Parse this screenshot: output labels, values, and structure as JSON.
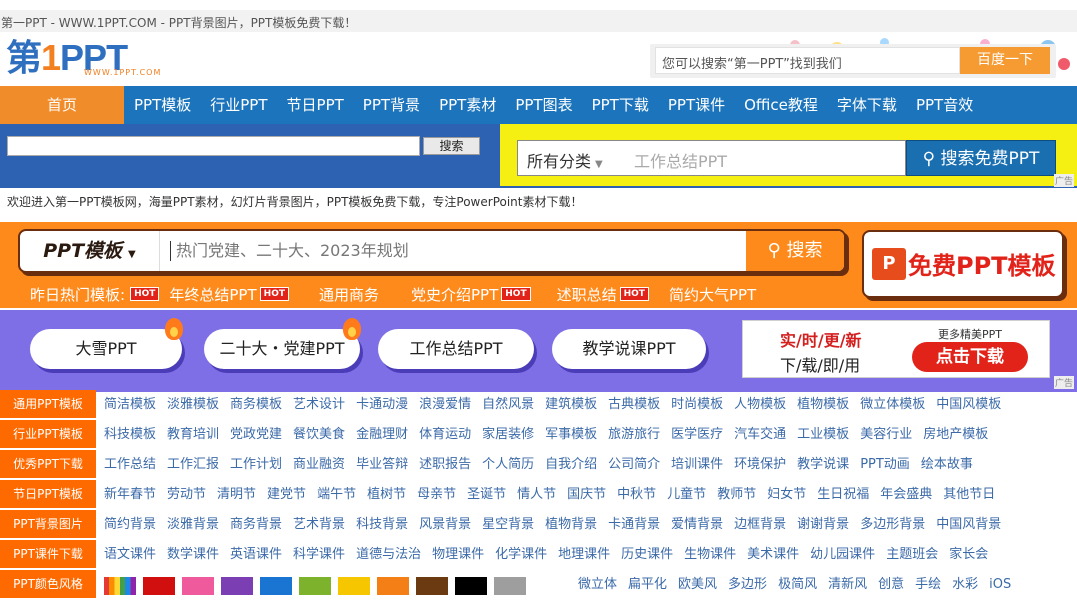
{
  "window": {
    "title": "第一PPT - WWW.1PPT.COM - PPT背景图片，PPT模板免费下载！"
  },
  "logo": {
    "main_prefix": "第",
    "main_one": "1",
    "main_suffix": "PPT",
    "url": "WWW.1PPT.COM"
  },
  "top_search": {
    "placeholder": "您可以搜索“第一PPT”找到我们",
    "button": "百度一下"
  },
  "nav": {
    "home": "首页",
    "items": [
      "PPT模板",
      "行业PPT",
      "节日PPT",
      "PPT背景",
      "PPT素材",
      "PPT图表",
      "PPT下载",
      "PPT课件",
      "Office教程",
      "字体下载",
      "PPT音效"
    ]
  },
  "site_search": {
    "button": "搜索",
    "category": "所有分类",
    "placeholder": "工作总结PPT",
    "submit": "搜索免费PPT",
    "ad_tag": "广告"
  },
  "welcome": "欢迎进入第一PPT模板网，海量PPT素材，幻灯片背景图片，PPT模板免费下载，专注PowerPoint素材下载！",
  "ppt_search": {
    "type": "PPT模板",
    "placeholder": "热门党建、二十大、2023年规划",
    "button": "搜索"
  },
  "free_banner": {
    "logo": "P",
    "text": "免费PPT模板"
  },
  "hot": {
    "label": "昨日热门模板:",
    "badge": "HOT",
    "items": [
      {
        "label": "年终总结PPT",
        "hot": true
      },
      {
        "label": "通用商务",
        "hot": false
      },
      {
        "label": "党史介绍PPT",
        "hot": true
      },
      {
        "label": "述职总结",
        "hot": true
      },
      {
        "label": "简约大气PPT",
        "hot": false
      }
    ]
  },
  "pills": [
    "大雪PPT",
    "二十大・党建PPT",
    "工作总结PPT",
    "教学说课PPT"
  ],
  "promo": {
    "line1": "实/时/更/新",
    "line2": "下/载/即/用",
    "more": "更多精美PPT",
    "button": "点击下载",
    "ad_tag": "广告"
  },
  "categories": [
    {
      "label": "通用PPT模板",
      "items": [
        "简洁模板",
        "淡雅模板",
        "商务模板",
        "艺术设计",
        "卡通动漫",
        "浪漫爱情",
        "自然风景",
        "建筑模板",
        "古典模板",
        "时尚模板",
        "人物模板",
        "植物模板",
        "微立体模板",
        "中国风模板"
      ]
    },
    {
      "label": "行业PPT模板",
      "items": [
        "科技模板",
        "教育培训",
        "党政党建",
        "餐饮美食",
        "金融理财",
        "体育运动",
        "家居装修",
        "军事模板",
        "旅游旅行",
        "医学医疗",
        "汽车交通",
        "工业模板",
        "美容行业",
        "房地产模板"
      ]
    },
    {
      "label": "优秀PPT下载",
      "items": [
        "工作总结",
        "工作汇报",
        "工作计划",
        "商业融资",
        "毕业答辩",
        "述职报告",
        "个人简历",
        "自我介绍",
        "公司简介",
        "培训课件",
        "环境保护",
        "教学说课",
        "PPT动画",
        "绘本故事"
      ]
    },
    {
      "label": "节日PPT模板",
      "items": [
        "新年春节",
        "劳动节",
        "清明节",
        "建党节",
        "端午节",
        "植树节",
        "母亲节",
        "圣诞节",
        "情人节",
        "国庆节",
        "中秋节",
        "儿童节",
        "教师节",
        "妇女节",
        "生日祝福",
        "年会盛典",
        "其他节日"
      ]
    },
    {
      "label": "PPT背景图片",
      "items": [
        "简约背景",
        "淡雅背景",
        "商务背景",
        "艺术背景",
        "科技背景",
        "风景背景",
        "星空背景",
        "植物背景",
        "卡通背景",
        "爱情背景",
        "边框背景",
        "谢谢背景",
        "多边形背景",
        "中国风背景"
      ]
    },
    {
      "label": "PPT课件下载",
      "items": [
        "语文课件",
        "数学课件",
        "英语课件",
        "科学课件",
        "道德与法治",
        "物理课件",
        "化学课件",
        "地理课件",
        "历史课件",
        "生物课件",
        "美术课件",
        "幼儿园课件",
        "主题班会",
        "家长会"
      ]
    }
  ],
  "colors_row": {
    "label": "PPT颜色风格",
    "swatches": [
      "rainbow",
      "#d20f0f",
      "#ee5a9b",
      "#7b3fb3",
      "#1a74d2",
      "#7cb22c",
      "#f6c600",
      "#f57f17",
      "#6b3a10",
      "#000000",
      "#9e9e9e",
      "#111111"
    ],
    "styles": [
      "微立体",
      "扁平化",
      "欧美风",
      "多边形",
      "极简风",
      "清新风",
      "创意",
      "手绘",
      "水彩",
      "iOS"
    ]
  },
  "colors": {
    "orange": "#ff8a1c",
    "blue": "#1c75bc",
    "yellow": "#f6f012",
    "purple": "#7e6fe6",
    "red": "#e2231a"
  }
}
